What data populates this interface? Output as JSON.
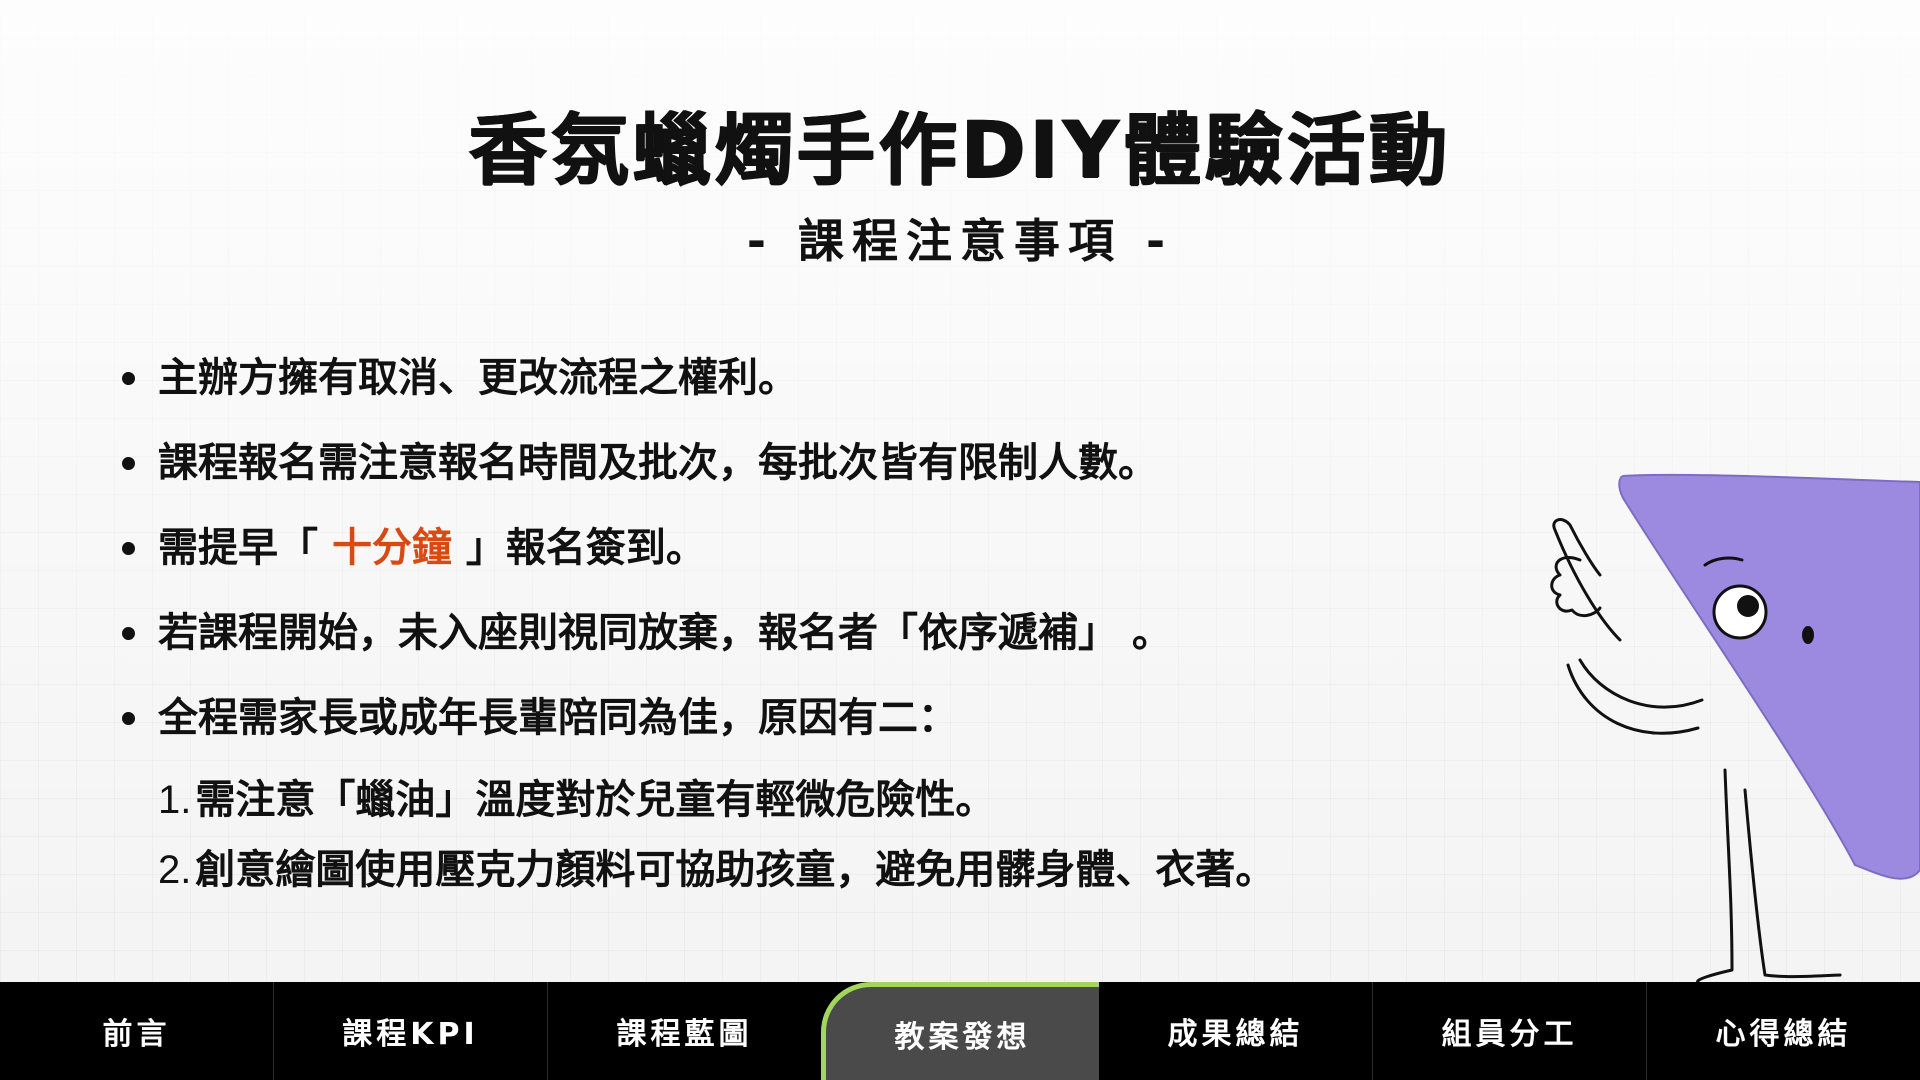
{
  "header": {
    "title": "香氛蠟燭手作DIY體驗活動",
    "subtitle": "- 課程注意事項 -"
  },
  "bullets": [
    {
      "text": "主辦方擁有取消、更改流程之權利。"
    },
    {
      "text": "課程報名需注意報名時間及批次，每批次皆有限制人數。"
    },
    {
      "pre": "需提早「 ",
      "highlight": "十分鐘",
      "post": " 」報名簽到。"
    },
    {
      "text": "若課程開始，未入座則視同放棄，報名者「依序遞補」 。"
    },
    {
      "text": "全程需家長或成年長輩陪同為佳，原因有二："
    }
  ],
  "sub_items": [
    {
      "num": "1.",
      "text": "需注意「蠟油」溫度對於兒童有輕微危險性。"
    },
    {
      "num": "2.",
      "text": "創意繪圖使用壓克力顏料可協助孩童，避免用髒身體、衣著。"
    }
  ],
  "colors": {
    "highlight": "#d84a12",
    "nav_bg": "#000000",
    "nav_active_bg": "#4a4a4a",
    "nav_active_accent": "#a3d65c",
    "character": "#9b8ae0"
  },
  "nav": {
    "items": [
      {
        "label": "前言"
      },
      {
        "label": "課程KPI"
      },
      {
        "label": "課程藍圖"
      },
      {
        "label": "教案發想",
        "active": true
      },
      {
        "label": "成果總結"
      },
      {
        "label": "組員分工"
      },
      {
        "label": "心得總結"
      }
    ]
  }
}
